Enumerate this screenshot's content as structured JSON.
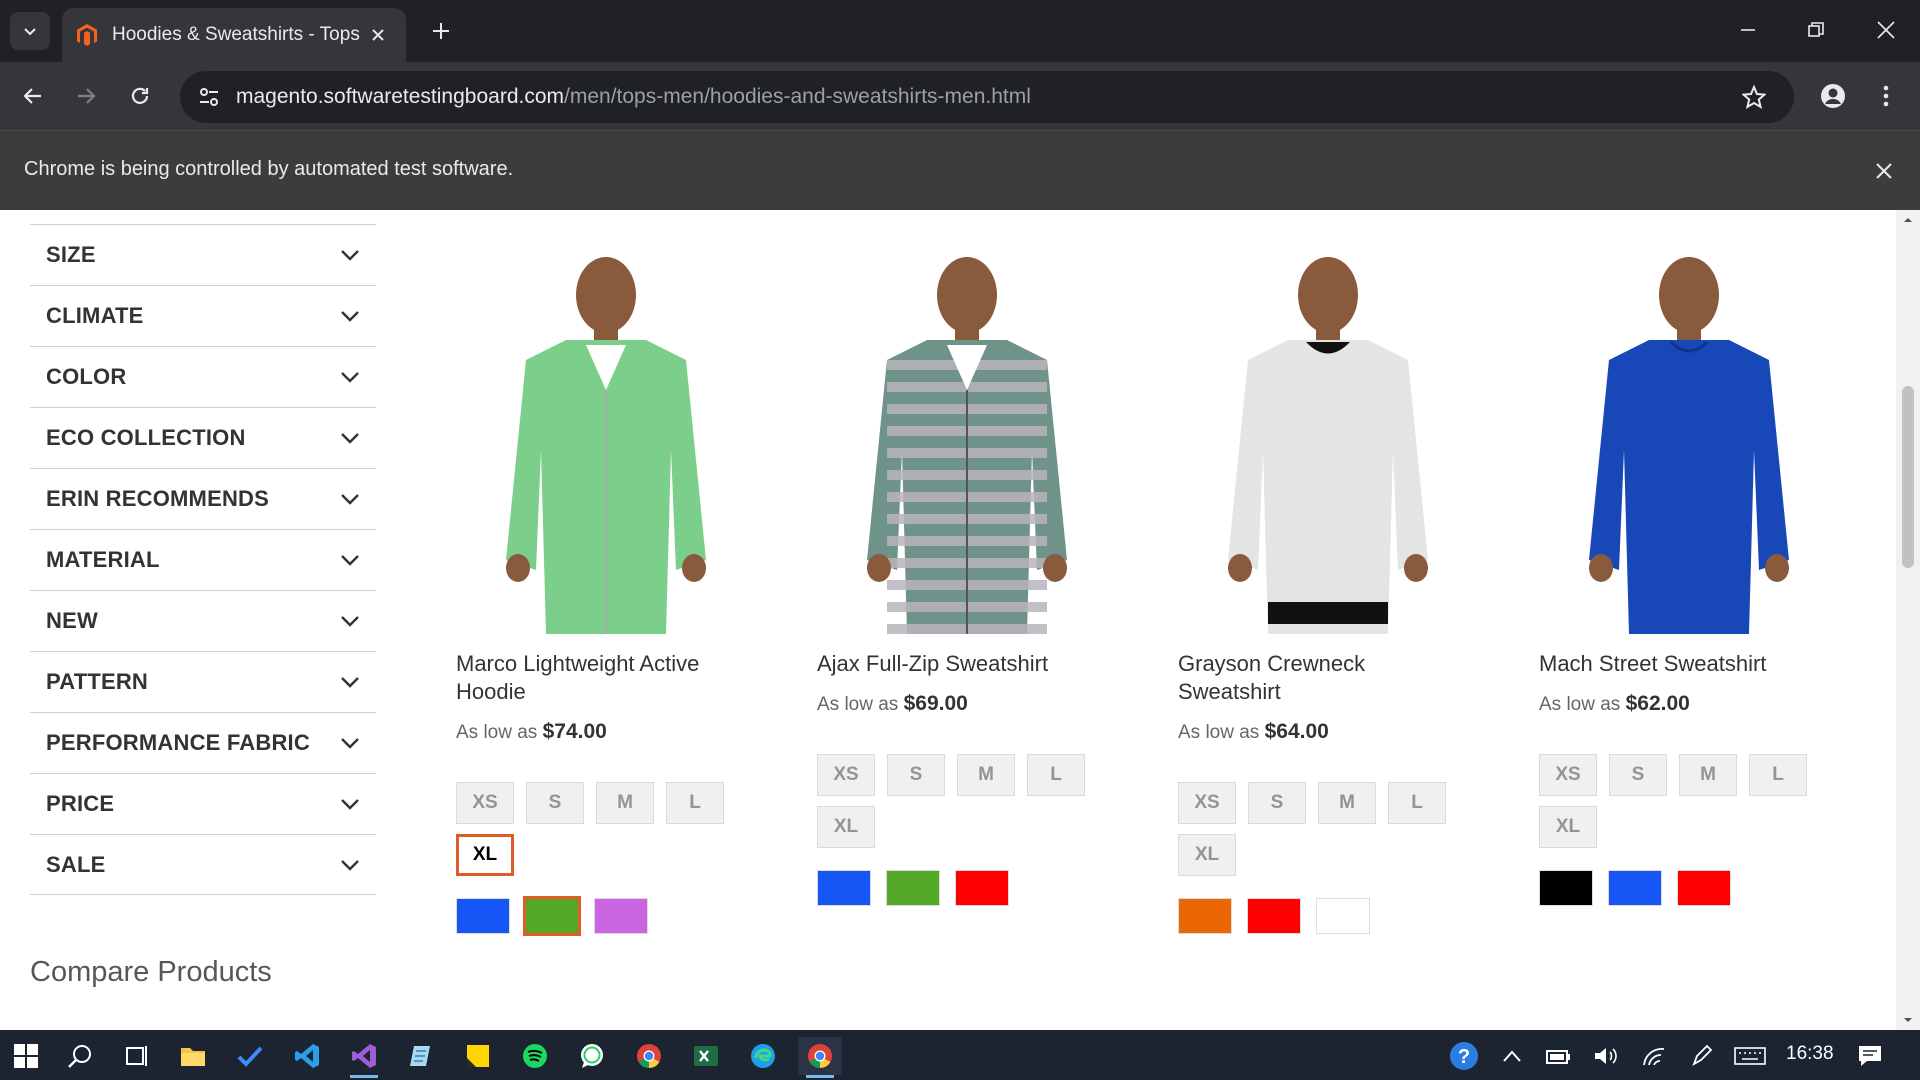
{
  "browser": {
    "tab_title": "Hoodies & Sweatshirts - Tops -",
    "url_host": "magento.softwaretestingboard.com",
    "url_path": "/men/tops-men/hoodies-and-sweatshirts-men.html",
    "infobar_text": "Chrome is being controlled by automated test software."
  },
  "filters": [
    {
      "label": "SIZE"
    },
    {
      "label": "CLIMATE"
    },
    {
      "label": "COLOR"
    },
    {
      "label": "ECO COLLECTION"
    },
    {
      "label": "ERIN RECOMMENDS"
    },
    {
      "label": "MATERIAL"
    },
    {
      "label": "NEW"
    },
    {
      "label": "PATTERN"
    },
    {
      "label": "PERFORMANCE FABRIC"
    },
    {
      "label": "PRICE"
    },
    {
      "label": "SALE"
    }
  ],
  "compare_heading": "Compare Products",
  "price_prefix": "As low as",
  "products": [
    {
      "name": "Marco Lightweight Active Hoodie",
      "price": "$74.00",
      "garment_color": "#7ccf8a",
      "sizes": [
        "XS",
        "S",
        "M",
        "L",
        "XL"
      ],
      "selected_size": "XL",
      "swatches": [
        "#1857f7",
        "#53a828",
        "#ca64e0"
      ],
      "selected_swatch": 1
    },
    {
      "name": "Ajax Full-Zip Sweatshirt",
      "price": "$69.00",
      "garment_color": "#6f9289",
      "sizes": [
        "XS",
        "S",
        "M",
        "L",
        "XL"
      ],
      "selected_size": "",
      "swatches": [
        "#1857f7",
        "#53a828",
        "#ff0000"
      ],
      "selected_swatch": -1
    },
    {
      "name": "Grayson Crewneck Sweatshirt",
      "price": "$64.00",
      "garment_color": "#e4e4e4",
      "sizes": [
        "XS",
        "S",
        "M",
        "L",
        "XL"
      ],
      "selected_size": "",
      "swatches": [
        "#eb6703",
        "#ff0000",
        "#ffffff"
      ],
      "selected_swatch": -1
    },
    {
      "name": "Mach Street Sweatshirt",
      "price": "$62.00",
      "garment_color": "#1847b8",
      "sizes": [
        "XS",
        "S",
        "M",
        "L",
        "XL"
      ],
      "selected_size": "",
      "swatches": [
        "#000000",
        "#1857f7",
        "#ff0000"
      ],
      "selected_swatch": -1
    }
  ],
  "taskbar": {
    "clock": "16:38",
    "apps": [
      "start-icon",
      "search-icon",
      "task-view-icon",
      "file-explorer-icon",
      "todo-icon",
      "vscode-icon",
      "visual-studio-icon",
      "notepad-icon",
      "sticky-notes-icon",
      "spotify-icon",
      "whatsapp-icon",
      "chrome-icon",
      "excel-icon",
      "edge-icon",
      "chrome-active-icon"
    ]
  },
  "colors": {
    "accent": "#e05b2a",
    "chrome_dark": "#202124"
  }
}
